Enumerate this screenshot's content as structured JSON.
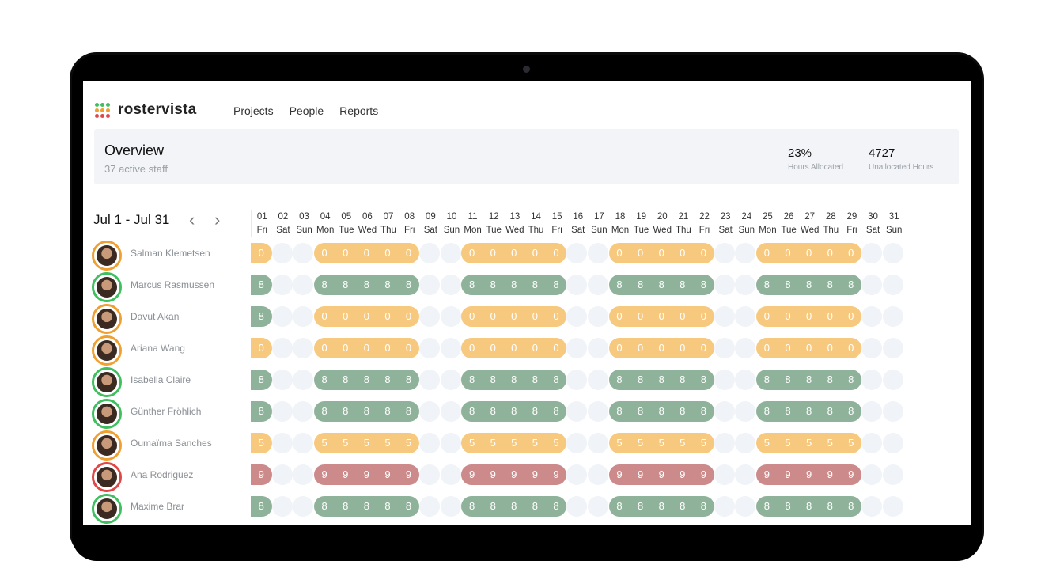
{
  "app": {
    "brand": "rostervista",
    "logo_colors": [
      "#3fbf5f",
      "#3fbf5f",
      "#3fbf5f",
      "#f0a030",
      "#f0a030",
      "#f0a030",
      "#e04848",
      "#e04848",
      "#e04848"
    ]
  },
  "nav": [
    {
      "label": "Projects"
    },
    {
      "label": "People"
    },
    {
      "label": "Reports"
    }
  ],
  "overview": {
    "title": "Overview",
    "subtitle": "37 active staff",
    "stats": [
      {
        "value": "23%",
        "label": "Hours Allocated"
      },
      {
        "value": "4727",
        "label": "Unallocated Hours"
      }
    ]
  },
  "calendar": {
    "range": "Jul 1 - Jul 31",
    "prev_icon": "chevron-left",
    "next_icon": "chevron-right",
    "days": [
      {
        "d": "01",
        "w": "Fri"
      },
      {
        "d": "02",
        "w": "Sat"
      },
      {
        "d": "03",
        "w": "Sun"
      },
      {
        "d": "04",
        "w": "Mon"
      },
      {
        "d": "05",
        "w": "Tue"
      },
      {
        "d": "06",
        "w": "Wed"
      },
      {
        "d": "07",
        "w": "Thu"
      },
      {
        "d": "08",
        "w": "Fri"
      },
      {
        "d": "09",
        "w": "Sat"
      },
      {
        "d": "10",
        "w": "Sun"
      },
      {
        "d": "11",
        "w": "Mon"
      },
      {
        "d": "12",
        "w": "Tue"
      },
      {
        "d": "13",
        "w": "Wed"
      },
      {
        "d": "14",
        "w": "Thu"
      },
      {
        "d": "15",
        "w": "Fri"
      },
      {
        "d": "16",
        "w": "Sat"
      },
      {
        "d": "17",
        "w": "Sun"
      },
      {
        "d": "18",
        "w": "Mon"
      },
      {
        "d": "19",
        "w": "Tue"
      },
      {
        "d": "20",
        "w": "Wed"
      },
      {
        "d": "21",
        "w": "Thu"
      },
      {
        "d": "22",
        "w": "Fri"
      },
      {
        "d": "23",
        "w": "Sat"
      },
      {
        "d": "24",
        "w": "Sun"
      },
      {
        "d": "25",
        "w": "Mon"
      },
      {
        "d": "26",
        "w": "Tue"
      },
      {
        "d": "27",
        "w": "Wed"
      },
      {
        "d": "28",
        "w": "Thu"
      },
      {
        "d": "29",
        "w": "Fri"
      },
      {
        "d": "30",
        "w": "Sat"
      },
      {
        "d": "31",
        "w": "Sun"
      }
    ]
  },
  "colors": {
    "orange": "#f7c97e",
    "green": "#8fb39a",
    "red": "#cc8a8a",
    "ring_orange": "#f0a030",
    "ring_green": "#3fbf5f",
    "ring_red": "#e04848",
    "empty": "#f0f3f7"
  },
  "staff": [
    {
      "name": "Salman Klemetsen",
      "ring": "orange",
      "first": {
        "v": "0",
        "c": "orange"
      },
      "week": {
        "v": "0",
        "c": "orange"
      }
    },
    {
      "name": "Marcus Rasmussen",
      "ring": "green",
      "first": {
        "v": "8",
        "c": "green"
      },
      "week": {
        "v": "8",
        "c": "green"
      }
    },
    {
      "name": "Davut Akan",
      "ring": "orange",
      "first": {
        "v": "8",
        "c": "green"
      },
      "week": {
        "v": "0",
        "c": "orange"
      }
    },
    {
      "name": "Ariana Wang",
      "ring": "orange",
      "first": {
        "v": "0",
        "c": "orange"
      },
      "week": {
        "v": "0",
        "c": "orange"
      }
    },
    {
      "name": "Isabella Claire",
      "ring": "green",
      "first": {
        "v": "8",
        "c": "green"
      },
      "week": {
        "v": "8",
        "c": "green"
      }
    },
    {
      "name": "Günther Fröhlich",
      "ring": "green",
      "first": {
        "v": "8",
        "c": "green"
      },
      "week": {
        "v": "8",
        "c": "green"
      }
    },
    {
      "name": "Oumaïma Sanches",
      "ring": "orange",
      "first": {
        "v": "5",
        "c": "orange"
      },
      "week": {
        "v": "5",
        "c": "orange"
      }
    },
    {
      "name": "Ana Rodriguez",
      "ring": "red",
      "first": {
        "v": "9",
        "c": "red"
      },
      "week": {
        "v": "9",
        "c": "red"
      }
    },
    {
      "name": "Maxime Brar",
      "ring": "green",
      "first": {
        "v": "8",
        "c": "green"
      },
      "week": {
        "v": "8",
        "c": "green"
      }
    }
  ]
}
